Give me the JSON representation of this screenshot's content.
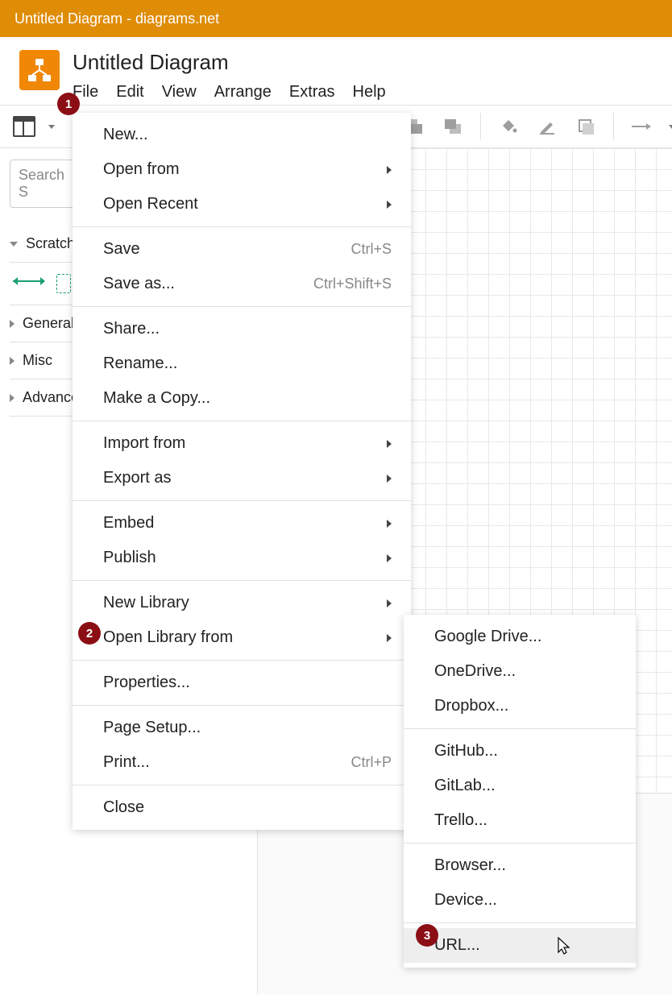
{
  "window_title": "Untitled Diagram - diagrams.net",
  "doc_title": "Untitled Diagram",
  "menubar": {
    "file": "File",
    "edit": "Edit",
    "view": "View",
    "arrange": "Arrange",
    "extras": "Extras",
    "help": "Help"
  },
  "search_placeholder": "Search S",
  "sidebar": {
    "scratchpad": "Scratchp",
    "general": "General",
    "misc": "Misc",
    "advanced": "Advance"
  },
  "file_menu": {
    "new": "New...",
    "open_from": "Open from",
    "open_recent": "Open Recent",
    "save": "Save",
    "save_shortcut": "Ctrl+S",
    "save_as": "Save as...",
    "save_as_shortcut": "Ctrl+Shift+S",
    "share": "Share...",
    "rename": "Rename...",
    "make_copy": "Make a Copy...",
    "import_from": "Import from",
    "export_as": "Export as",
    "embed": "Embed",
    "publish": "Publish",
    "new_library": "New Library",
    "open_library_from": "Open Library from",
    "properties": "Properties...",
    "page_setup": "Page Setup...",
    "print": "Print...",
    "print_shortcut": "Ctrl+P",
    "close": "Close"
  },
  "submenu_open_library": {
    "google_drive": "Google Drive...",
    "onedrive": "OneDrive...",
    "dropbox": "Dropbox...",
    "github": "GitHub...",
    "gitlab": "GitLab...",
    "trello": "Trello...",
    "browser": "Browser...",
    "device": "Device...",
    "url": "URL..."
  },
  "badges": {
    "b1": "1",
    "b2": "2",
    "b3": "3"
  }
}
